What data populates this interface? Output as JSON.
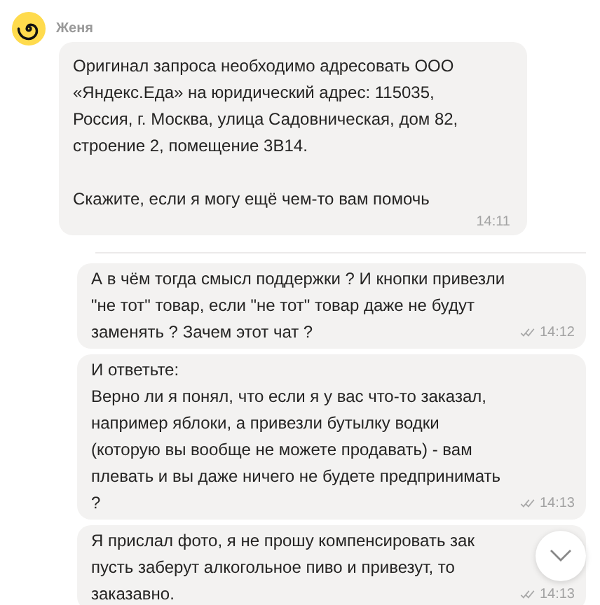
{
  "sender": {
    "name": "Женя"
  },
  "messages": [
    {
      "kind": "incoming",
      "paragraphs": [
        [
          "Оригинал запроса необходимо адресовать ООО",
          "«Яндекс.Еда» на юридический адрес: 115035,",
          "Россия, г. Москва, улица Садовническая, дом 82,",
          "строение 2, помещение 3В14."
        ],
        [
          "Скажите, если я могу ещё чем-то вам помочь"
        ]
      ],
      "time": "14:11",
      "read": false
    },
    {
      "kind": "outgoing",
      "paragraphs": [
        [
          "А в чём тогда смысл поддержки ? И кнопки привезли",
          "\"не тот\" товар, если \"не тот\" товар даже не будут",
          "заменять ? Зачем этот чат ?"
        ]
      ],
      "time": "14:12",
      "read": true
    },
    {
      "kind": "outgoing",
      "paragraphs": [
        [
          "И ответьте:",
          "Верно ли я понял, что если я у вас что-то заказал,",
          "например яблоки, а привезли бутылку водки",
          "(которую вы вообще не можете продавать) - вам",
          "плевать и вы даже ничего не будете предпринимать",
          "?"
        ]
      ],
      "time": "14:13",
      "read": true
    },
    {
      "kind": "outgoing",
      "paragraphs": [
        [
          "Я прислал фото, я не прошу компенсировать зак",
          "пусть заберут алкогольное пиво и привезут, то",
          "заказавно."
        ]
      ],
      "time": "14:13",
      "read": true
    }
  ]
}
